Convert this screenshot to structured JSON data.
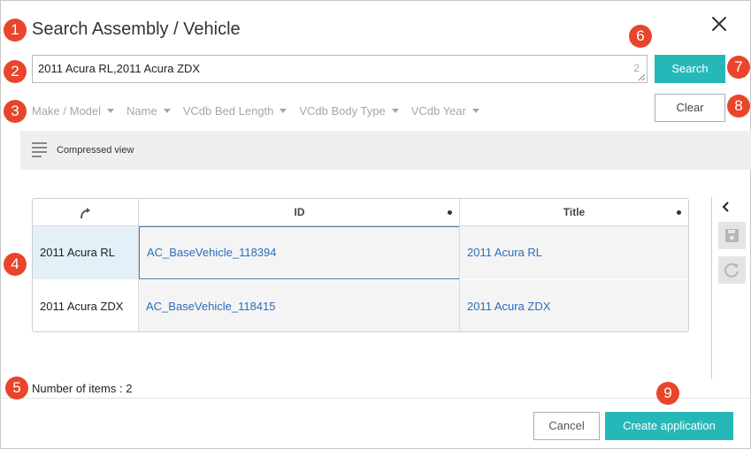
{
  "dialog": {
    "title": "Search Assembly / Vehicle"
  },
  "markers": [
    "1",
    "2",
    "3",
    "4",
    "5",
    "6",
    "7",
    "8",
    "9"
  ],
  "search": {
    "value": "2011 Acura RL,2011 Acura ZDX",
    "count": "2",
    "button_label": "Search",
    "clear_label": "Clear"
  },
  "filters": [
    {
      "label": "Make / Model"
    },
    {
      "label": "Name"
    },
    {
      "label": "VCdb Bed Length"
    },
    {
      "label": "VCdb Body Type"
    },
    {
      "label": "VCdb Year"
    }
  ],
  "view": {
    "label": "Compressed view"
  },
  "grid": {
    "columns": [
      {
        "label": ""
      },
      {
        "label": "ID"
      },
      {
        "label": "Title"
      }
    ],
    "rows": [
      {
        "name": "2011 Acura RL",
        "id": "AC_BaseVehicle_118394",
        "title": "2011 Acura RL"
      },
      {
        "name": "2011 Acura ZDX",
        "id": "AC_BaseVehicle_118415",
        "title": "2011 Acura ZDX"
      }
    ]
  },
  "footer": {
    "count_label": "Number of items : 2",
    "cancel_label": "Cancel",
    "create_label": "Create application"
  },
  "colors": {
    "accent": "#26b8b8",
    "marker": "#e8452c",
    "link": "#2a6ebb",
    "selected_row": "#e3f0f8",
    "selected_border": "#4a7ea3"
  }
}
